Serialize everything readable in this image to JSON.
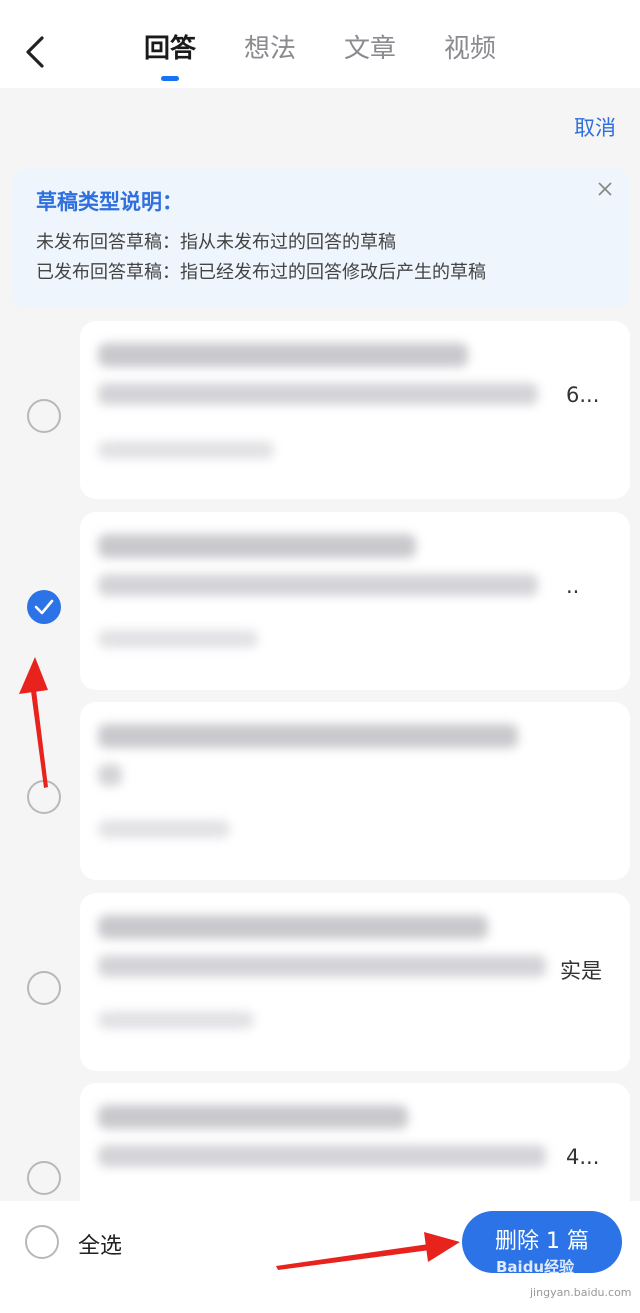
{
  "header": {
    "tabs": [
      {
        "label": "回答",
        "active": true
      },
      {
        "label": "想法",
        "active": false
      },
      {
        "label": "文章",
        "active": false
      },
      {
        "label": "视频",
        "active": false
      }
    ],
    "cancel_label": "取消"
  },
  "info_card": {
    "title": "草稿类型说明：",
    "lines": [
      "未发布回答草稿：指从未发布过的回答的草稿",
      "已发布回答草稿：指已经发布过的回答修改后产生的草稿"
    ]
  },
  "drafts": [
    {
      "checked": false,
      "tail": "6..."
    },
    {
      "checked": true,
      "tail": ".."
    },
    {
      "checked": false,
      "tail": ""
    },
    {
      "checked": false,
      "tail": "实是"
    },
    {
      "checked": false,
      "tail": "4..."
    }
  ],
  "footer": {
    "select_all_label": "全选",
    "delete_label": "删除 1 篇"
  },
  "watermark": {
    "text": "Baidu经验",
    "sub": "jingyan.baidu.com"
  },
  "colors": {
    "accent": "#2b73e6",
    "link": "#2f6fde",
    "arrow": "#e8231d"
  }
}
